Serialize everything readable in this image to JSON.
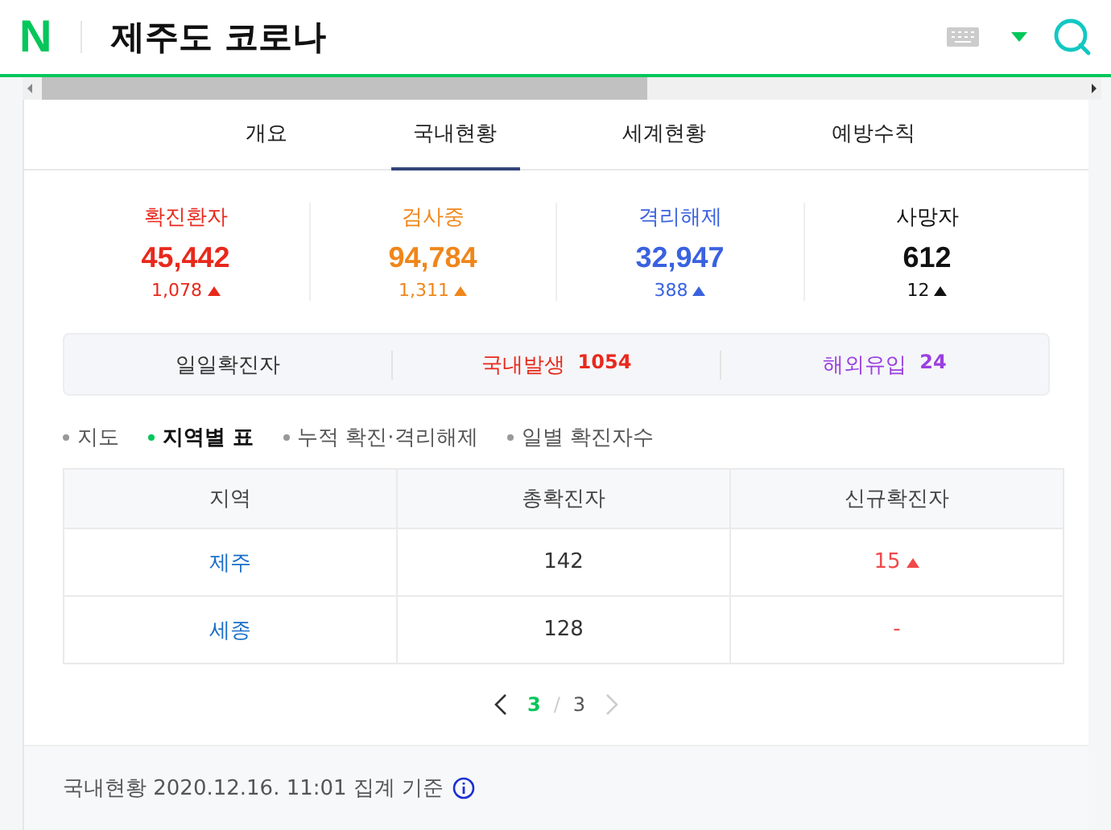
{
  "header": {
    "logo": "N",
    "query": "제주도 코로나"
  },
  "tabs": [
    {
      "label": "개요",
      "selected": false
    },
    {
      "label": "국내현황",
      "selected": true
    },
    {
      "label": "세계현황",
      "selected": false
    },
    {
      "label": "예방수칙",
      "selected": false
    }
  ],
  "stats": [
    {
      "label": "확진환자",
      "value": "45,442",
      "change": "1,078",
      "color": "#e8291c"
    },
    {
      "label": "검사중",
      "value": "94,784",
      "change": "1,311",
      "color": "#f0861a"
    },
    {
      "label": "격리해제",
      "value": "32,947",
      "change": "388",
      "color": "#3a62e0"
    },
    {
      "label": "사망자",
      "value": "612",
      "change": "12",
      "color": "#111111"
    }
  ],
  "daily": [
    {
      "label": "일일확진자",
      "color": "#333333"
    },
    {
      "label": "국내발생",
      "value": "1054",
      "color": "#e8291c"
    },
    {
      "label": "해외유입",
      "value": "24",
      "color": "#9a3fe0"
    }
  ],
  "subtabs": [
    {
      "label": "지도",
      "selected": false
    },
    {
      "label": "지역별 표",
      "selected": true
    },
    {
      "label": "누적 확진·격리해제",
      "selected": false
    },
    {
      "label": "일별 확진자수",
      "selected": false
    }
  ],
  "table": {
    "columns": [
      "지역",
      "총확진자",
      "신규확진자"
    ],
    "rows": [
      {
        "region": "제주",
        "total": "142",
        "new": "15",
        "up": true
      },
      {
        "region": "세종",
        "total": "128",
        "new": "-",
        "up": false
      }
    ]
  },
  "pagination": {
    "current": "3",
    "separator": "/",
    "total": "3",
    "prev_disabled": false,
    "next_disabled": true
  },
  "footer": {
    "text": "국내현황 2020.12.16. 11:01 집계 기준"
  }
}
